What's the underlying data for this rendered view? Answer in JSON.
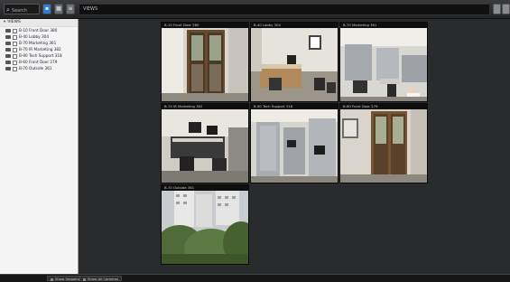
{
  "toolbar": {
    "search_placeholder": "Search",
    "views_tab_label": "VIEWS"
  },
  "sidebar": {
    "root_label": "VIEWS",
    "items": [
      {
        "label": "B-10 Front Door 380"
      },
      {
        "label": "B-40 Lobby 304"
      },
      {
        "label": "B-70 Marketing 361"
      },
      {
        "label": "B-70 IR Marketing 382"
      },
      {
        "label": "B-90 Tech Support 318"
      },
      {
        "label": "B-60 Front Door 279"
      },
      {
        "label": "B-70 Outside 361"
      }
    ]
  },
  "cameras": [
    {
      "label": "B-10 Front Door 380",
      "scene": "door"
    },
    {
      "label": "B-40 Lobby 304",
      "scene": "lobby"
    },
    {
      "label": "B-70 Marketing 361",
      "scene": "marketing"
    },
    {
      "label": "B-70 IR Marketing 382",
      "scene": "office"
    },
    {
      "label": "B-90 Tech Support 318",
      "scene": "cubicles"
    },
    {
      "label": "B-60 Front Door 279",
      "scene": "door2"
    },
    {
      "label": "B-70 Outside 361",
      "scene": "outside"
    }
  ],
  "bottombar": {
    "left_button": "Show Sequence",
    "right_button": "Show All Cameras"
  },
  "colors": {
    "accent": "#2f7fd3",
    "background": "#2a2b2d"
  }
}
